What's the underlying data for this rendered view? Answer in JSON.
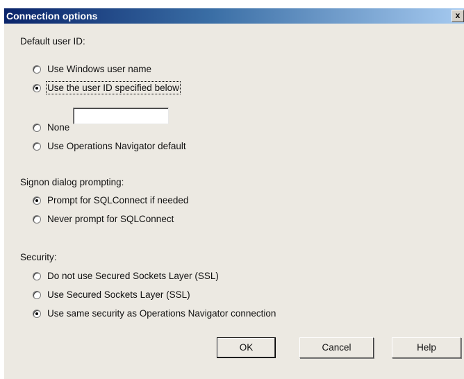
{
  "window": {
    "title": "Connection options",
    "close_label": "x"
  },
  "default_user": {
    "label": "Default user ID:",
    "options": [
      {
        "label": "Use Windows user name",
        "checked": false
      },
      {
        "label": "Use the user ID specified below",
        "checked": true
      },
      {
        "label": "None",
        "checked": false
      },
      {
        "label": "Use Operations Navigator default",
        "checked": false
      }
    ],
    "user_id_value": ""
  },
  "signon": {
    "label": "Signon dialog prompting:",
    "options": [
      {
        "label": "Prompt for SQLConnect if needed",
        "checked": true
      },
      {
        "label": "Never prompt for SQLConnect",
        "checked": false
      }
    ]
  },
  "security": {
    "label": "Security:",
    "options": [
      {
        "label": "Do not use Secured Sockets Layer (SSL)",
        "checked": false
      },
      {
        "label": "Use Secured Sockets Layer (SSL)",
        "checked": false
      },
      {
        "label": "Use same security as Operations Navigator connection",
        "checked": true
      }
    ]
  },
  "buttons": {
    "ok": "OK",
    "cancel": "Cancel",
    "help": "Help"
  }
}
